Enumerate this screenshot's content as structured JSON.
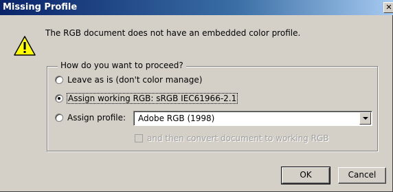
{
  "window": {
    "title": "Missing Profile",
    "close_glyph": "✕"
  },
  "message": "The RGB document does not have an embedded color profile.",
  "group": {
    "legend": "How do you want to proceed?",
    "options": [
      {
        "label": "Leave as is (don't color manage)",
        "checked": false
      },
      {
        "label": "Assign working RGB:  sRGB IEC61966-2.1",
        "checked": true
      },
      {
        "label": "Assign profile:",
        "checked": false
      }
    ],
    "profile_select": {
      "value": "Adobe RGB (1998)"
    },
    "convert_checkbox": {
      "label": "and then convert document to working RGB",
      "checked": false,
      "enabled": false
    }
  },
  "buttons": {
    "ok": "OK",
    "cancel": "Cancel"
  },
  "icons": {
    "warning": "warning-icon"
  },
  "colors": {
    "dialog_bg": "#d4d0c8",
    "titlebar_start": "#0a246a",
    "titlebar_end": "#a6caf0",
    "warning_fill": "#ffff00"
  }
}
